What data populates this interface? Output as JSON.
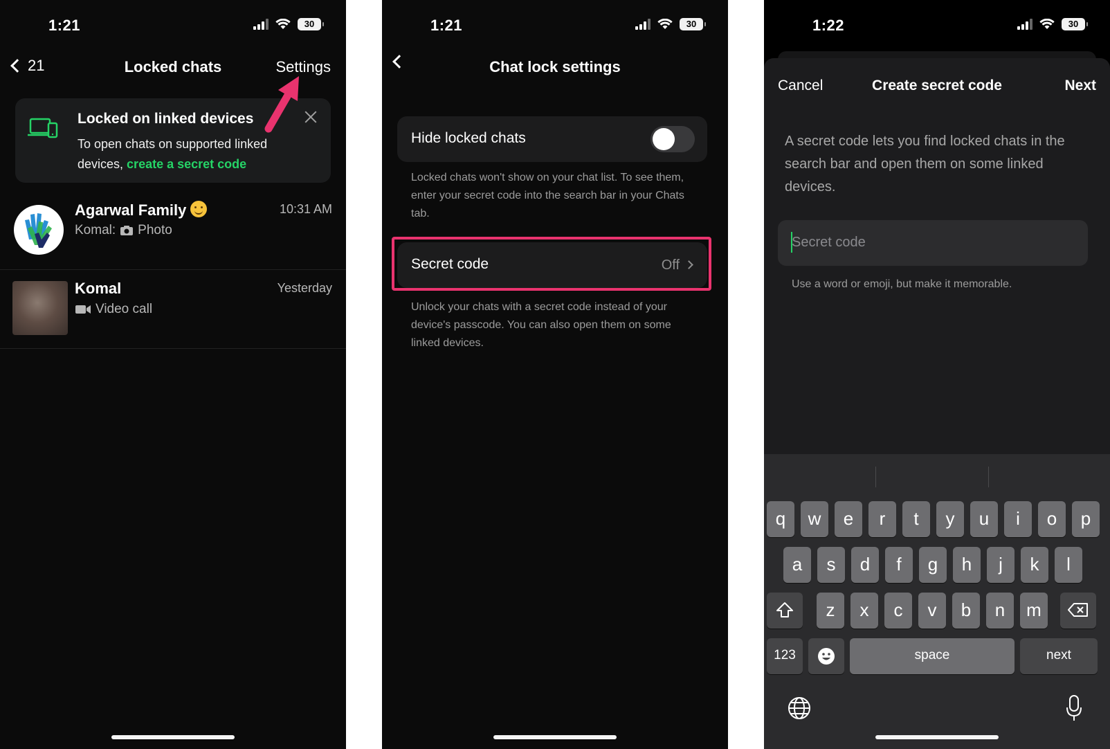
{
  "screens": [
    {
      "status": {
        "time": "1:21",
        "battery": "30"
      },
      "nav": {
        "back_count": "21",
        "title": "Locked chats",
        "right_action": "Settings"
      },
      "banner": {
        "title": "Locked on linked devices",
        "body": "To open chats on supported linked devices, ",
        "link": "create a secret code",
        "icon": "linked-devices-icon"
      },
      "chats": [
        {
          "name": "Agarwal Family",
          "preview_sender": "Komal:",
          "preview_text": "Photo",
          "time": "10:31 AM",
          "preview_icon": "camera-icon"
        },
        {
          "name": "Komal",
          "preview_text": "Video call",
          "time": "Yesterday",
          "preview_icon": "video-icon"
        }
      ],
      "annotation_color": "#e9336e"
    },
    {
      "status": {
        "time": "1:21",
        "battery": "30"
      },
      "nav": {
        "title": "Chat lock settings"
      },
      "hide_locked": {
        "label": "Hide locked chats",
        "enabled": false
      },
      "hide_note": "Locked chats won't show on your chat list. To see them, enter your secret code into the search bar in your Chats tab.",
      "secret_code": {
        "label": "Secret code",
        "value": "Off"
      },
      "secret_note": "Unlock your chats with a secret code instead of your device's passcode. You can also open them on some linked devices."
    },
    {
      "status": {
        "time": "1:22",
        "battery": "30"
      },
      "sheet": {
        "cancel": "Cancel",
        "title": "Create secret code",
        "next": "Next",
        "description": "A secret code lets you find locked chats in the search bar and open them on some linked devices.",
        "input_placeholder": "Secret code",
        "hint": "Use a word or emoji, but make it memorable."
      },
      "keyboard": {
        "row1": [
          "q",
          "w",
          "e",
          "r",
          "t",
          "y",
          "u",
          "i",
          "o",
          "p"
        ],
        "row2": [
          "a",
          "s",
          "d",
          "f",
          "g",
          "h",
          "j",
          "k",
          "l"
        ],
        "row3": [
          "z",
          "x",
          "c",
          "v",
          "b",
          "n",
          "m"
        ],
        "numbers_key": "123",
        "space_key": "space",
        "return_key": "next"
      }
    }
  ],
  "colors": {
    "accent_green": "#25d366",
    "background": "#0b0b0b",
    "highlight": "#e9336e"
  }
}
